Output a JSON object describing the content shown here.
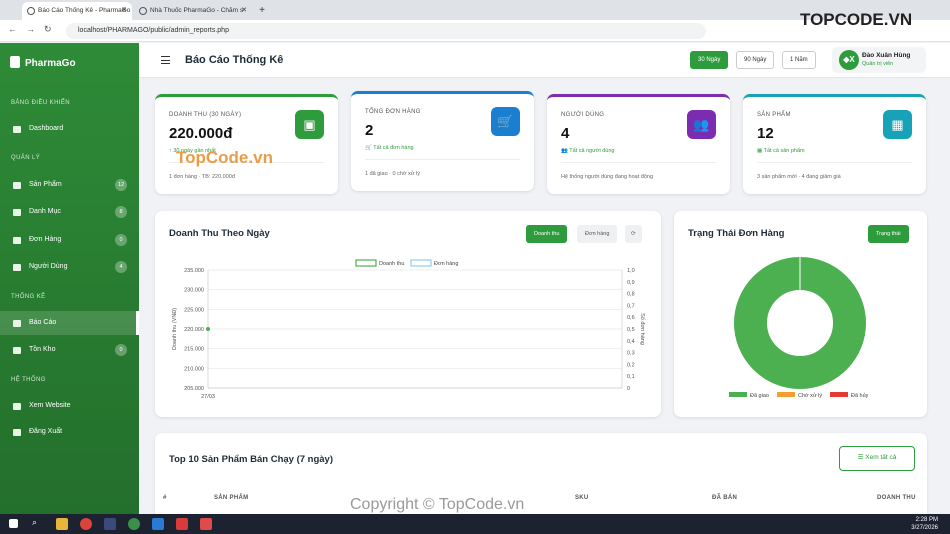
{
  "browser": {
    "tabs": [
      {
        "title": "Báo Cáo Thống Kê - PharmaGo"
      },
      {
        "title": "Nhà Thuốc PharmaGo - Chăm s"
      }
    ],
    "url": "localhost/PHARMAGO/public/admin_reports.php"
  },
  "sidebar": {
    "brand": "PharmaGo",
    "sections": [
      {
        "title": "BẢNG ĐIỀU KHIỂN"
      },
      {
        "title": "QUẢN LÝ"
      },
      {
        "title": "THỐNG KÊ"
      },
      {
        "title": "HỆ THỐNG"
      }
    ],
    "items": [
      {
        "label": "Dashboard",
        "icon": "dashboard-icon"
      },
      {
        "label": "Sản Phẩm",
        "icon": "pills-icon",
        "count": "12"
      },
      {
        "label": "Danh Mục",
        "icon": "tag-icon",
        "count": "8"
      },
      {
        "label": "Đơn Hàng",
        "icon": "cart-icon",
        "count": "0"
      },
      {
        "label": "Người Dùng",
        "icon": "users-icon",
        "count": "4"
      },
      {
        "label": "Báo Cáo",
        "icon": "report-icon"
      },
      {
        "label": "Tồn Kho",
        "icon": "warehouse-icon",
        "count": "0"
      },
      {
        "label": "Xem Website",
        "icon": "external-link-icon"
      },
      {
        "label": "Đăng Xuất",
        "icon": "logout-icon"
      }
    ]
  },
  "header": {
    "title": "Báo Cáo Thống Kê",
    "ranges": [
      "30 Ngày",
      "90 Ngày",
      "1 Năm"
    ],
    "active_range": "30 Ngày",
    "user": {
      "initials": "◆X",
      "name": "Đào Xuân Hùng",
      "role": "Quản trị viên"
    }
  },
  "stats": [
    {
      "label": "DOANH THU (30 NGÀY)",
      "value": "220.000đ",
      "link": "30 ngày gần nhất",
      "foot": "1 đơn hàng · TB: 220.000đ",
      "color": "#2e9c3c",
      "icon": "money-icon"
    },
    {
      "label": "TỔNG ĐƠN HÀNG",
      "value": "2",
      "link": "Tất cả đơn hàng",
      "foot": "1 đã giao · 0 chờ xử lý",
      "color": "#1a7fd1",
      "icon": "cart-icon"
    },
    {
      "label": "NGƯỜI DÙNG",
      "value": "4",
      "link": "Tất cả người dùng",
      "foot": "Hệ thống người dùng đang hoạt động",
      "color": "#7b2cb0",
      "icon": "users-icon"
    },
    {
      "label": "SẢN PHẨM",
      "value": "12",
      "link": "Tất cả sản phẩm",
      "foot": "3 sản phẩm mới · 4 đang giảm giá",
      "color": "#17a2b8",
      "icon": "boxes-icon"
    }
  ],
  "revenue_panel": {
    "title": "Doanh Thu Theo Ngày",
    "buttons": [
      "Doanh thu",
      "Đơn hàng"
    ],
    "active": "Doanh thu"
  },
  "status_panel": {
    "title": "Trạng Thái Đơn Hàng",
    "button": "Trạng thái"
  },
  "chart_data": [
    {
      "type": "line",
      "x": [
        "27/03"
      ],
      "series": [
        {
          "name": "Doanh thu",
          "values": [
            220000
          ],
          "axis": "left",
          "color": "#4caf50"
        },
        {
          "name": "Đơn hàng",
          "values": [
            1
          ],
          "axis": "right",
          "color": "#90cde8"
        }
      ],
      "ylabel": "Doanh thu (VNĐ)",
      "y2label": "Số đơn hàng",
      "ylim": [
        205000,
        235000
      ],
      "y_ticks": [
        "235.000",
        "230.000",
        "225.000",
        "220.000",
        "215.000",
        "210.000",
        "205.000"
      ],
      "y2lim": [
        0,
        1
      ],
      "y2_ticks": [
        "1,0",
        "0,9",
        "0,8",
        "0,7",
        "0,6",
        "0,5",
        "0,4",
        "0,3",
        "0,2",
        "0,1",
        "0"
      ],
      "grid": true,
      "legend": "top"
    },
    {
      "type": "pie",
      "donut": true,
      "labels": [
        "Đã giao",
        "Chờ xử lý",
        "Đã hủy"
      ],
      "values": [
        1,
        0,
        0
      ],
      "colors": [
        "#4caf50",
        "#f0a030",
        "#e53935"
      ],
      "legend": "bottom"
    }
  ],
  "top_products": {
    "title": "Top 10 Sản Phẩm Bán Chạy (7 ngày)",
    "view_all": "Xem tất cả",
    "columns": [
      "#",
      "SẢN PHẨM",
      "SKU",
      "ĐÃ BÁN",
      "DOANH THU"
    ]
  },
  "taskbar": {
    "time": "2:28 PM",
    "date": "3/27/2026"
  },
  "watermarks": {
    "logo": "TOPCODE.VN",
    "overlay": "TopCode.vn",
    "footer": "Copyright © TopCode.vn"
  }
}
